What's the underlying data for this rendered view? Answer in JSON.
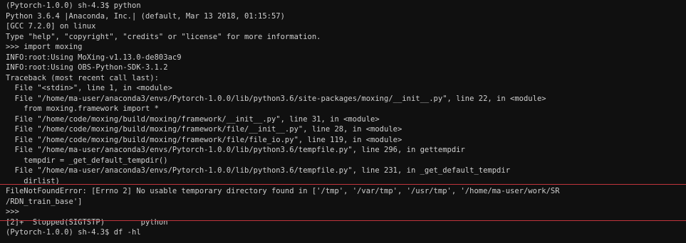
{
  "terminal": {
    "lines": [
      "(Pytorch-1.0.0) sh-4.3$ python",
      "Python 3.6.4 |Anaconda, Inc.| (default, Mar 13 2018, 01:15:57)",
      "[GCC 7.2.0] on linux",
      "Type \"help\", \"copyright\", \"credits\" or \"license\" for more information.",
      ">>> import moxing",
      "INFO:root:Using MoXing-v1.13.0-de803ac9",
      "INFO:root:Using OBS-Python-SDK-3.1.2",
      "Traceback (most recent call last):",
      "  File \"<stdin>\", line 1, in <module>",
      "  File \"/home/ma-user/anaconda3/envs/Pytorch-1.0.0/lib/python3.6/site-packages/moxing/__init__.py\", line 22, in <module>",
      "    from moxing.framework import *",
      "  File \"/home/code/moxing/build/moxing/framework/__init__.py\", line 31, in <module>",
      "  File \"/home/code/moxing/build/moxing/framework/file/__init__.py\", line 28, in <module>",
      "  File \"/home/code/moxing/build/moxing/framework/file/file_io.py\", line 119, in <module>",
      "  File \"/home/ma-user/anaconda3/envs/Pytorch-1.0.0/lib/python3.6/tempfile.py\", line 296, in gettempdir",
      "    tempdir = _get_default_tempdir()",
      "  File \"/home/ma-user/anaconda3/envs/Pytorch-1.0.0/lib/python3.6/tempfile.py\", line 231, in _get_default_tempdir",
      "    dirlist)",
      "FileNotFoundError: [Errno 2] No usable temporary directory found in ['/tmp', '/var/tmp', '/usr/tmp', '/home/ma-user/work/SR",
      "/RDN_train_base']",
      ">>>",
      "[2]+  Stopped(SIGTSTP)        python",
      "(Pytorch-1.0.0) sh-4.3$ df -hl"
    ]
  },
  "colors": {
    "background": "#101010",
    "foreground": "#cfcfcf",
    "highlight_border": "#c0353b"
  }
}
